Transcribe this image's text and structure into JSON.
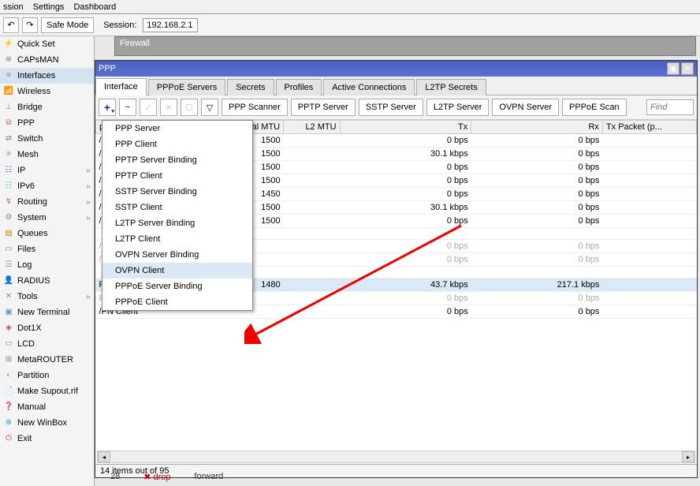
{
  "topmenu": {
    "items": [
      "ssion",
      "Settings",
      "Dashboard"
    ]
  },
  "toolbar": {
    "safe_mode": "Safe Mode",
    "session_label": "Session:",
    "session_value": "192.168.2.1"
  },
  "sidebar": {
    "items": [
      {
        "icon": "⚡",
        "label": "Quick Set",
        "color": "#c80"
      },
      {
        "icon": "⊕",
        "label": "CAPsMAN",
        "color": "#888"
      },
      {
        "icon": "≡",
        "label": "Interfaces",
        "color": "#888",
        "active": true
      },
      {
        "icon": "📶",
        "label": "Wireless",
        "color": "#39c"
      },
      {
        "icon": "⊥",
        "label": "Bridge",
        "color": "#69c"
      },
      {
        "icon": "⧉",
        "label": "PPP",
        "color": "#c66"
      },
      {
        "icon": "⇄",
        "label": "Switch",
        "color": "#888"
      },
      {
        "icon": "✳",
        "label": "Mesh",
        "color": "#6c6"
      },
      {
        "icon": "☷",
        "label": "IP",
        "color": "#69c",
        "sub": true
      },
      {
        "icon": "☷",
        "label": "IPv6",
        "color": "#6cc",
        "sub": true
      },
      {
        "icon": "↯",
        "label": "Routing",
        "color": "#c66",
        "sub": true
      },
      {
        "icon": "⚙",
        "label": "System",
        "color": "#888",
        "sub": true
      },
      {
        "icon": "▤",
        "label": "Queues",
        "color": "#c80"
      },
      {
        "icon": "▭",
        "label": "Files",
        "color": "#888"
      },
      {
        "icon": "☰",
        "label": "Log",
        "color": "#999"
      },
      {
        "icon": "👤",
        "label": "RADIUS",
        "color": "#c66"
      },
      {
        "icon": "✕",
        "label": "Tools",
        "color": "#888",
        "sub": true
      },
      {
        "icon": "▣",
        "label": "New Terminal",
        "color": "#69c"
      },
      {
        "icon": "◈",
        "label": "Dot1X",
        "color": "#c44"
      },
      {
        "icon": "▭",
        "label": "LCD",
        "color": "#888"
      },
      {
        "icon": "⊞",
        "label": "MetaROUTER",
        "color": "#888"
      },
      {
        "icon": "◐",
        "label": "Partition",
        "color": "#6c6"
      },
      {
        "icon": "📄",
        "label": "Make Supout.rif",
        "color": "#69c"
      },
      {
        "icon": "❓",
        "label": "Manual",
        "color": "#39c"
      },
      {
        "icon": "⊕",
        "label": "New WinBox",
        "color": "#39c"
      },
      {
        "icon": "⏻",
        "label": "Exit",
        "color": "#c44"
      }
    ]
  },
  "firewall": {
    "title": "Firewall"
  },
  "ppp": {
    "title": "PPP",
    "tabs": [
      "Interface",
      "PPPoE Servers",
      "Secrets",
      "Profiles",
      "Active Connections",
      "L2TP Secrets"
    ],
    "active_tab": 0,
    "toolbar_buttons": [
      "PPP Scanner",
      "PPTP Server",
      "SSTP Server",
      "L2TP Server",
      "OVPN Server",
      "PPPoE Scan"
    ],
    "find_placeholder": "Find",
    "columns": [
      "pe",
      "Actual MTU",
      "L2 MTU",
      "Tx",
      "Rx",
      "Tx Packet (p..."
    ],
    "rows": [
      {
        "type": "/PN Server Binding",
        "mtu": "1500",
        "l2mtu": "",
        "tx": "0 bps",
        "rx": "0 bps"
      },
      {
        "type": "/PN Server Binding",
        "mtu": "1500",
        "l2mtu": "",
        "tx": "30.1 kbps",
        "rx": "0 bps"
      },
      {
        "type": "/PN Server Binding",
        "mtu": "1500",
        "l2mtu": "",
        "tx": "0 bps",
        "rx": "0 bps"
      },
      {
        "type": "/PN Server Binding",
        "mtu": "1500",
        "l2mtu": "",
        "tx": "0 bps",
        "rx": "0 bps"
      },
      {
        "type": "/PN Server Binding",
        "mtu": "1450",
        "l2mtu": "",
        "tx": "0 bps",
        "rx": "0 bps"
      },
      {
        "type": "/PN Server Binding",
        "mtu": "1500",
        "l2mtu": "",
        "tx": "30.1 kbps",
        "rx": "0 bps"
      },
      {
        "type": "/PN Server Binding",
        "mtu": "1500",
        "l2mtu": "",
        "tx": "0 bps",
        "rx": "0 bps"
      },
      {
        "type": "",
        "l2mtu": "",
        "tx": "",
        "rx": "",
        "grey": true
      },
      {
        "type": "/PN Client",
        "mtu": "",
        "l2mtu": "",
        "tx": "0 bps",
        "rx": "0 bps",
        "grey": true
      },
      {
        "type": "/PN Client",
        "mtu": "",
        "l2mtu": "",
        "tx": "0 bps",
        "rx": "0 bps",
        "grey": true
      },
      {
        "type": "",
        "l2mtu": "",
        "tx": "",
        "rx": "",
        "grey": true
      },
      {
        "type": "PoE Client",
        "mtu": "1480",
        "l2mtu": "",
        "tx": "43.7 kbps",
        "rx": "217.1 kbps",
        "sel": true
      },
      {
        "type": "E Client",
        "mtu": "",
        "l2mtu": "",
        "tx": "0 bps",
        "rx": "0 bps",
        "grey": true
      },
      {
        "type": "/PN Client",
        "mtu": "",
        "l2mtu": "",
        "tx": "0 bps",
        "rx": "0 bps"
      }
    ],
    "status": "14 items out of 95"
  },
  "dropdown": {
    "items": [
      "PPP Server",
      "PPP Client",
      "PPTP Server Binding",
      "PPTP Client",
      "SSTP Server Binding",
      "SSTP Client",
      "L2TP Server Binding",
      "L2TP Client",
      "OVPN Server Binding",
      "OVPN Client",
      "PPPoE Server Binding",
      "PPPoE Client"
    ],
    "hover_index": 9
  },
  "fw_peek": {
    "num": "28",
    "action": "✖ drop",
    "chain": "forward"
  }
}
